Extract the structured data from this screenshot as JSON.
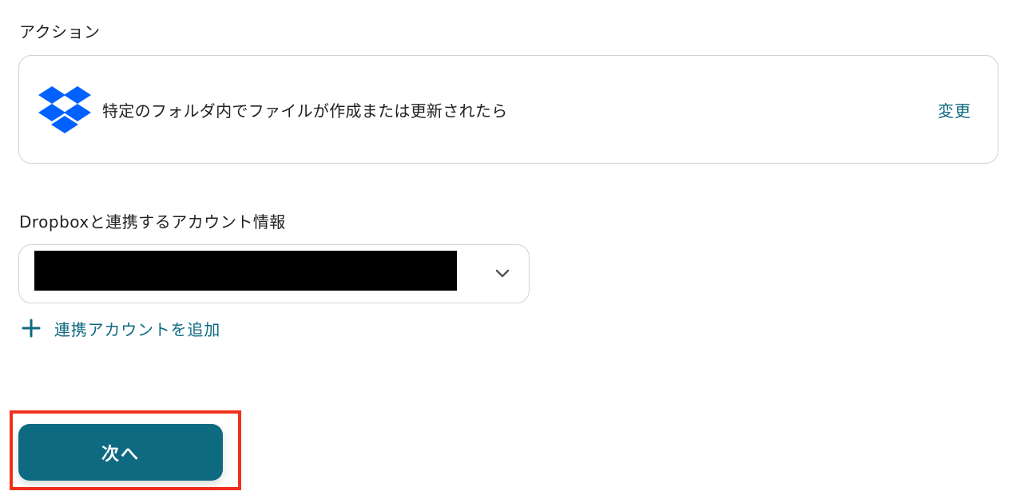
{
  "action_section": {
    "label": "アクション",
    "card": {
      "app_icon": "dropbox-icon",
      "trigger_text": "特定のフォルダ内でファイルが作成または更新されたら",
      "change_label": "変更"
    }
  },
  "account_section": {
    "label": "Dropboxと連携するアカウント情報",
    "select": {
      "value": "",
      "value_redacted": true,
      "icon": "chevron-down-icon"
    },
    "add_account": {
      "icon": "plus-icon",
      "label": "連携アカウントを追加"
    }
  },
  "footer": {
    "next_label": "次へ"
  },
  "colors": {
    "accent": "#0e6a80",
    "dropbox_blue": "#0061fe",
    "highlight": "#f0301e",
    "border": "#cfd3d6"
  }
}
